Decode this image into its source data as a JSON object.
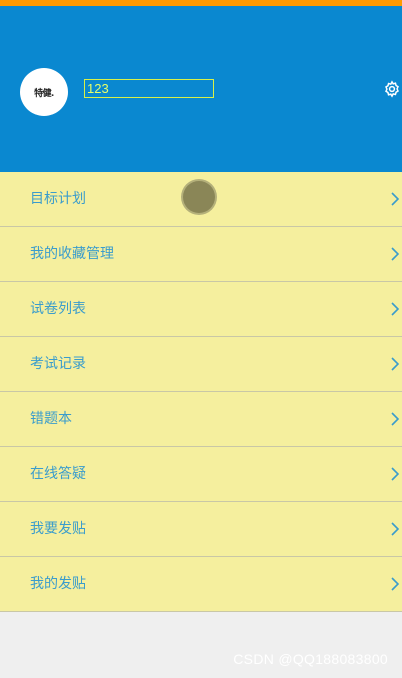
{
  "header": {
    "avatar_text": "特健.",
    "username": "123",
    "settings_icon": "gear-icon"
  },
  "menu": {
    "items": [
      {
        "label": "目标计划"
      },
      {
        "label": "我的收藏管理"
      },
      {
        "label": "试卷列表"
      },
      {
        "label": "考试记录"
      },
      {
        "label": "错题本"
      },
      {
        "label": "在线答疑"
      },
      {
        "label": "我要发贴"
      },
      {
        "label": "我的发贴"
      }
    ],
    "chevron_icon": "chevron-right-icon"
  },
  "watermark": "CSDN @QQ188083800",
  "colors": {
    "top_strip": "#ff9900",
    "header_bg": "#0a88d0",
    "menu_bg": "#f5ef9e",
    "menu_text": "#3a9ccc",
    "page_bg": "#efefef"
  }
}
